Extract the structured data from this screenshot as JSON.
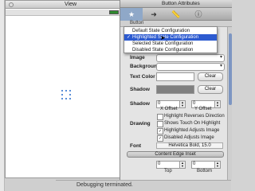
{
  "view_window": {
    "title": "View"
  },
  "status_bar": {
    "text": "Debugging terminated."
  },
  "inspector": {
    "title": "Button Attributes",
    "section": "Button",
    "tabs": [
      "★",
      "➜",
      "📏",
      "ⓘ"
    ],
    "state_menu": {
      "items": [
        "Default State Configuration",
        "Highlighted State Configuration",
        "Selected State Configuration",
        "Disabled State Configuration"
      ],
      "selected_index": 1
    },
    "labels": {
      "image": "Image",
      "background": "Background",
      "text_color": "Text Color",
      "shadow": "Shadow",
      "shadow_offset": "Shadow",
      "x_offset": "X Offset",
      "y_offset": "Y Offset",
      "drawing": "Drawing",
      "font": "Font",
      "top": "Top",
      "bottom": "Bottom"
    },
    "buttons": {
      "clear_text_color": "Clear",
      "clear_shadow": "Clear"
    },
    "fields": {
      "x_offset_value": "0",
      "y_offset_value": "0",
      "top_value": "0",
      "bottom_value": "0"
    },
    "checkboxes": [
      {
        "label": "Highlight Reverses Direction",
        "checked": false
      },
      {
        "label": "Shows Touch On Highlight",
        "checked": false
      },
      {
        "label": "Highlighted Adjusts Image",
        "checked": true
      },
      {
        "label": "Disabled Adjusts Image",
        "checked": true
      }
    ],
    "font_value": "Helvetica Bold, 15.0",
    "inset_popup": "Content Edge Inset",
    "colors": {
      "text_color": "#ffffff",
      "shadow": "#808080",
      "highlight": "#2d5bd0"
    }
  }
}
